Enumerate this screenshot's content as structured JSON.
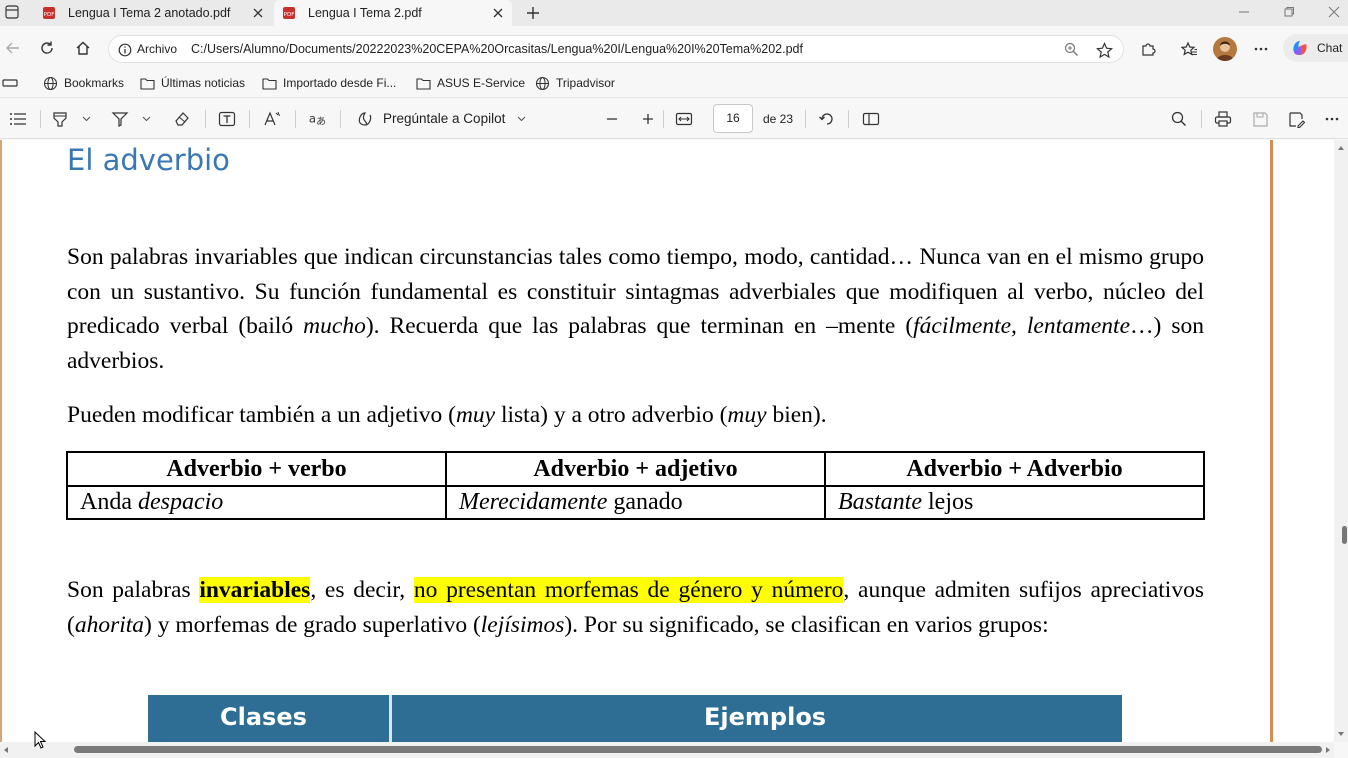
{
  "tabs": [
    {
      "title": "Lengua I Tema 2 anotado.pdf"
    },
    {
      "title": "Lengua I Tema 2.pdf"
    }
  ],
  "address": {
    "scheme_label": "Archivo",
    "url": "C:/Users/Alumno/Documents/20222023%20CEPA%20Orcasitas/Lengua%20I/Lengua%20I%20Tema%202.pdf"
  },
  "chat_label": "Chat",
  "bookmarks": [
    {
      "label": "Bookmarks"
    },
    {
      "label": "Últimas noticias"
    },
    {
      "label": "Importado desde Fi..."
    },
    {
      "label": "ASUS E-Service"
    },
    {
      "label": "Tripadvisor"
    }
  ],
  "pdf_toolbar": {
    "copilot_label": "Pregúntale a Copilot",
    "page_number": "16",
    "page_total": "de 23"
  },
  "document": {
    "title": "El adverbio",
    "p1": {
      "a": "Son palabras invariables que indican circunstancias tales como tiempo, modo, cantidad… Nunca van en el mismo grupo con un sustantivo. Su función fundamental es constituir sintagmas adverbiales que modifiquen al verbo, núcleo del predicado verbal (bailó ",
      "b": "mucho",
      "c": "). Recuerda que las palabras que terminan en –mente (",
      "d": "fácilmente, lentamente",
      "e": "…) son adverbios."
    },
    "p2": {
      "a": "Pueden modificar también a un adjetivo (",
      "b": "muy",
      "c": " lista) y a otro adverbio (",
      "d": "muy",
      "e": " bien)."
    },
    "table": {
      "headers": [
        "Adverbio + verbo",
        "Adverbio + adjetivo",
        "Adverbio + Adverbio"
      ],
      "row": [
        {
          "plain_before": "Anda ",
          "italic": "despacio",
          "plain_after": ""
        },
        {
          "plain_before": "",
          "italic": "Merecidamente",
          "plain_after": " ganado"
        },
        {
          "plain_before": "",
          "italic": "Bastante",
          "plain_after": " lejos"
        }
      ]
    },
    "p3": {
      "a": "Son palabras ",
      "b": "invariables",
      "c": ", es decir, ",
      "d": "no presentan morfemas de género y número",
      "e": ", aunque admiten sufijos apreciativos (",
      "f": "ahorita",
      "g": ") y morfemas de grado superlativo (",
      "h": "lejísimos",
      "i": "). Por su significado, se clasifican en varios grupos:"
    },
    "banner": {
      "col1": "Clases",
      "col2": "Ejemplos"
    }
  },
  "colors": {
    "title": "#3a78b5",
    "highlight": "#ffff00",
    "banner": "#2e6e95",
    "copilot": "#4f6bed"
  }
}
